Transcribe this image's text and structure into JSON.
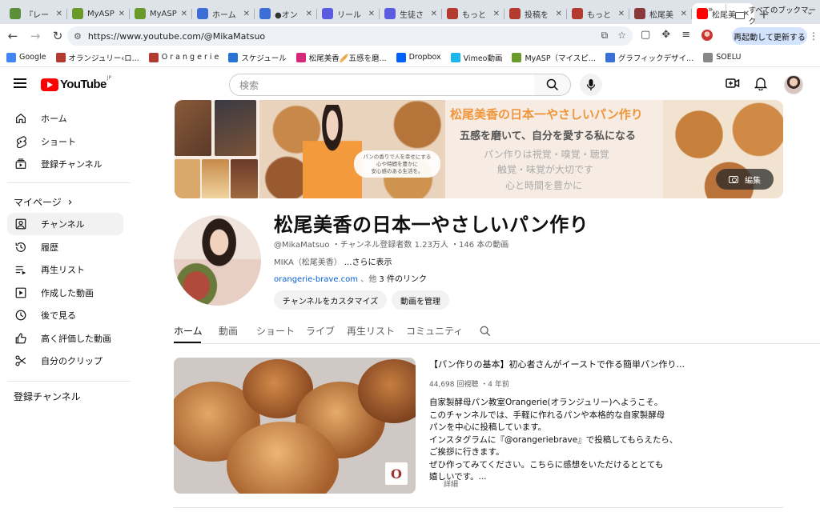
{
  "browser": {
    "tabs": [
      {
        "label": "『レー",
        "color": "#5b8f3a"
      },
      {
        "label": "MyASP",
        "color": "#6a9a2a"
      },
      {
        "label": "MyASP",
        "color": "#6a9a2a"
      },
      {
        "label": "ホーム",
        "color": "#3b6fd6"
      },
      {
        "label": "●オン",
        "color": "#3b6fd6"
      },
      {
        "label": "リール",
        "color": "#5b5be0"
      },
      {
        "label": "生徒さ",
        "color": "#5b5be0"
      },
      {
        "label": "もっと",
        "color": "#b33a2e"
      },
      {
        "label": "投稿を",
        "color": "#b33a2e"
      },
      {
        "label": "もっと",
        "color": "#b33a2e"
      },
      {
        "label": "松尾美",
        "color": "#8a3a3a"
      },
      {
        "label": "松尾美",
        "color": "#ff0000",
        "active": true
      }
    ],
    "url": "https://www.youtube.com/@MikaMatsuo",
    "restart_label": "再起動して更新する",
    "bookmarks": [
      {
        "label": "Google",
        "color": "#4285f4"
      },
      {
        "label": "オランジュリー‹ロ...",
        "color": "#b33a2e"
      },
      {
        "label": "O r a n g e r i e",
        "color": "#b33a2e"
      },
      {
        "label": "スケジュール",
        "color": "#2a73d6"
      },
      {
        "label": "松尾美香🥖五感を磨...",
        "color": "#d6297a"
      },
      {
        "label": "Dropbox",
        "color": "#0061fe"
      },
      {
        "label": "Vimeo動画",
        "color": "#1ab7ea"
      },
      {
        "label": "MyASP（マイスピ...",
        "color": "#6a9a2a"
      },
      {
        "label": "グラフィックデザイ...",
        "color": "#3b6fd6"
      },
      {
        "label": "SOELU",
        "color": "#888888"
      }
    ],
    "bookmarks_more": "»",
    "all_bookmarks": "すべてのブックマーク"
  },
  "yt": {
    "logo_text": "YouTube",
    "logo_region": "JP",
    "search_placeholder": "検索"
  },
  "sidebar": {
    "main": [
      {
        "label": "ホーム",
        "icon": "home-icon"
      },
      {
        "label": "ショート",
        "icon": "shorts-icon"
      },
      {
        "label": "登録チャンネル",
        "icon": "subscriptions-icon"
      }
    ],
    "you_heading": "マイページ",
    "you_items": [
      {
        "label": "チャンネル",
        "icon": "channel-icon",
        "active": true
      },
      {
        "label": "履歴",
        "icon": "history-icon"
      },
      {
        "label": "再生リスト",
        "icon": "playlist-icon"
      },
      {
        "label": "作成した動画",
        "icon": "your-videos-icon"
      },
      {
        "label": "後で見る",
        "icon": "watch-later-icon"
      },
      {
        "label": "高く評価した動画",
        "icon": "liked-icon"
      },
      {
        "label": "自分のクリップ",
        "icon": "clips-icon"
      }
    ],
    "subs_heading": "登録チャンネル"
  },
  "banner": {
    "title": "松尾美香の日本一やさしいパン作り",
    "subtitle": "五感を磨いて、自分を愛する私になる",
    "lines": [
      "パン作りは視覚・嗅覚・聴覚",
      "触覚・味覚が大切です",
      "心と時間を豊かに"
    ],
    "caption": [
      "パンの香りで人を幸せにする",
      "心や時間を豊かに",
      "安心感のある生活を。"
    ],
    "edit_label": "編集"
  },
  "channel": {
    "name": "松尾美香の日本一やさしいパン作り",
    "handle": "@MikaMatsuo",
    "subs": "チャンネル登録者数 1.23万人",
    "videos": "146 本の動画",
    "desc": "MIKA（松尾美香）",
    "more": "...さらに表示",
    "link": "orangerie-brave.com",
    "link_more_prefix": "、他",
    "link_more_count": "3 件のリンク",
    "customize_label": "チャンネルをカスタマイズ",
    "manage_label": "動画を管理"
  },
  "tabs": [
    "ホーム",
    "動画",
    "ショート",
    "ライブ",
    "再生リスト",
    "コミュニティ"
  ],
  "featured": {
    "title": "【パン作りの基本】初心者さんがイーストで作る簡単パン作り...",
    "views": "44,698 回視聴",
    "age": "4 年前",
    "desc": [
      "自家製酵母パン教室Orangerie(オランジュリー)へようこそ。",
      "このチャンネルでは、手軽に作れるパンや本格的な自家製酵母",
      "パンを中心に投稿しています。",
      "インスタグラムに『@orangeriebrave』で投稿してもらえたら、",
      "ご挨拶に行きます。",
      "ぜひ作ってみてください。こちらに感想をいただけるととても",
      "嬉しいです。..."
    ],
    "detail": "詳細",
    "thumb_logo": "O"
  }
}
